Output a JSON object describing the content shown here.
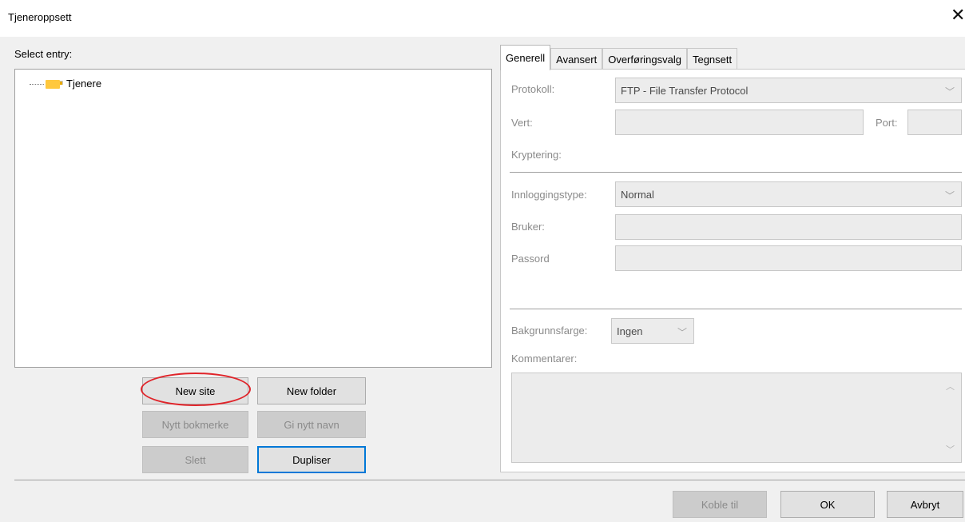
{
  "window": {
    "title": "Tjeneroppsett",
    "close_glyph": "✕"
  },
  "left": {
    "select_entry_label": "Select entry:",
    "tree": [
      {
        "label": "Tjenere",
        "icon": "folder-icon"
      }
    ],
    "buttons": {
      "new_site": "New site",
      "new_folder": "New folder",
      "new_bookmark": "Nytt bokmerke",
      "rename": "Gi nytt navn",
      "delete": "Slett",
      "duplicate": "Dupliser"
    }
  },
  "tabs": [
    "Generell",
    "Avansert",
    "Overføringsvalg",
    "Tegnsett"
  ],
  "general": {
    "protocol_label": "Protokoll:",
    "protocol_value": "FTP - File Transfer Protocol",
    "host_label": "Vert:",
    "host_value": "",
    "port_label": "Port:",
    "port_value": "",
    "encryption_label": "Kryptering:",
    "logon_type_label": "Innloggingstype:",
    "logon_type_value": "Normal",
    "user_label": "Bruker:",
    "user_value": "",
    "password_label": "Passord",
    "password_value": "",
    "bgcolor_label": "Bakgrunnsfarge:",
    "bgcolor_value": "Ingen",
    "comments_label": "Kommentarer:"
  },
  "footer": {
    "connect": "Koble til",
    "ok": "OK",
    "cancel": "Avbryt"
  },
  "colors": {
    "highlight": "#e0242a",
    "focus": "#0078d7",
    "folder": "#ffc83d"
  }
}
